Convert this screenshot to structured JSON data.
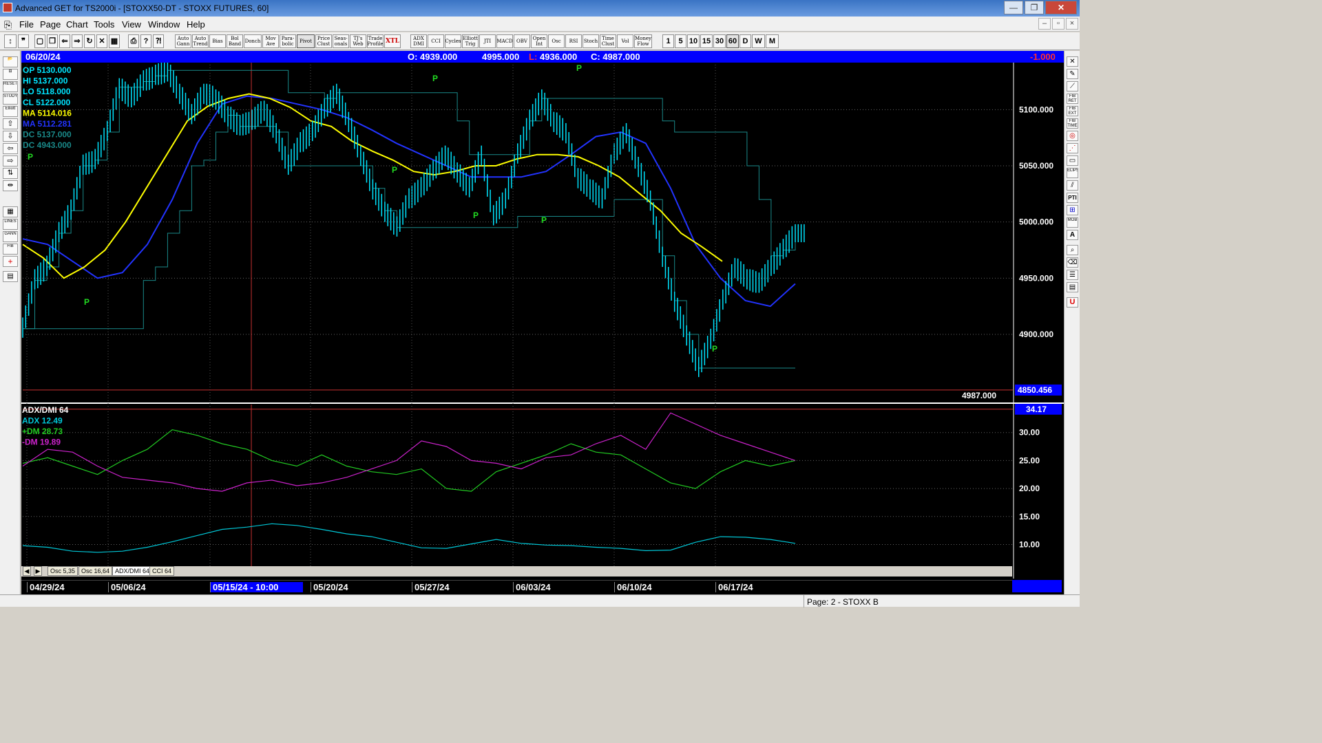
{
  "window": {
    "title": "Advanced GET for TS2000i - [STOXX50-DT - STOXX FUTURES, 60]",
    "controls": [
      "—",
      "❐",
      "✕"
    ],
    "mdi_controls": [
      "–",
      "▫",
      "×"
    ]
  },
  "menu": [
    "File",
    "Page",
    "Chart",
    "Tools",
    "View",
    "Window",
    "Help"
  ],
  "toolbar": {
    "studies": [
      "Auto Gann",
      "Auto Trend",
      "Bias",
      "Bol Band",
      "Donch",
      "Mov Ave",
      "Para-bolic",
      "Pivot",
      "Price Clust",
      "Seas-onals",
      "TJ's Web",
      "Trade Profile",
      "XTL",
      "ADX DMI",
      "CCI",
      "Cycles",
      "Elliott Trig",
      "JTI",
      "MACD",
      "OBV",
      "Open Int",
      "Osc",
      "RSI",
      "Stoch",
      "Time Clust",
      "Vol",
      "Money Flow"
    ],
    "timeframes": [
      "1",
      "5",
      "10",
      "15",
      "30",
      "60",
      "D",
      "W",
      "M"
    ],
    "active_timeframe": "60"
  },
  "info": {
    "date": "06/20/24",
    "open": "O: 4939.000",
    "high": "4995.000",
    "low_label": "L:",
    "low": "4936.000",
    "close": "C: 4987.000",
    "change": "-1.000"
  },
  "legend": [
    {
      "text": "OP  5130.000",
      "color": "#00e5ff"
    },
    {
      "text": "HI   5137.000",
      "color": "#00e5ff"
    },
    {
      "text": "LO  5118.000",
      "color": "#00e5ff"
    },
    {
      "text": "CL  5122.000",
      "color": "#00e5ff"
    },
    {
      "text": "MA  5114.016",
      "color": "#ffff00"
    },
    {
      "text": "MA  5112.281",
      "color": "#2233ff"
    },
    {
      "text": "DC  5137.000",
      "color": "#1a8a8a"
    },
    {
      "text": "DC  4943.000",
      "color": "#1a8a8a"
    }
  ],
  "price_axis": {
    "ticks": [
      "5100.000",
      "5050.000",
      "5000.000",
      "4950.000",
      "4900.000"
    ],
    "marker": "4850.456",
    "last_value": "4987.000"
  },
  "indicator": {
    "title": "ADX/DMI 64",
    "adx": "ADX 12.49",
    "plus_dm": "+DM 28.73",
    "minus_dm": "-DM  19.89",
    "marker": "34.17",
    "ticks": [
      "30.00",
      "25.00",
      "20.00",
      "15.00",
      "10.00"
    ],
    "colors": {
      "adx": "#00c8d8",
      "plus_dm": "#22cc22",
      "minus_dm": "#cc22cc"
    }
  },
  "tabs": [
    "Osc 5,35",
    "Osc 16,64",
    "ADX/DMI 64",
    "CCI 64"
  ],
  "active_tab": "ADX/DMI 64",
  "dates": [
    "04/29/24",
    "05/06/24",
    "05/15/24 - 10:00",
    "05/20/24",
    "05/27/24",
    "06/03/24",
    "06/10/24",
    "06/17/24"
  ],
  "pivot_label": "P",
  "status": "Page: 2 - STOXX B",
  "colors": {
    "price": "#00e5ff",
    "ma_fast": "#ffff00",
    "ma_slow": "#2233ff",
    "channel": "#1a8a8a",
    "pivot": "#22dd22",
    "cursor": "#c83232",
    "info_bg": "#0000ff"
  },
  "chart_data": [
    {
      "type": "line",
      "title": "",
      "series": [
        {
          "name": "",
          "values": [
            4905,
            4948,
            4960,
            4990,
            5010,
            5050,
            5055,
            5080,
            5120,
            5110,
            5125,
            5130,
            5135,
            5115,
            5095,
            5115,
            5110,
            5095,
            5085,
            5090,
            5100,
            5080,
            5050,
            5070,
            5080,
            5100,
            5115,
            5090,
            5060,
            5030,
            5010,
            4995,
            5020,
            5030,
            5045,
            5060,
            5045,
            5030,
            5060,
            5005,
            5020,
            5060,
            5090,
            5110,
            5090,
            5080,
            5040,
            5030,
            5020,
            5060,
            5080,
            5050,
            5020,
            4970,
            4930,
            4900,
            4870,
            4895,
            4930,
            4960,
            4950,
            4945,
            4960,
            4975,
            4990
          ]
        },
        {
          "name": "MA",
          "values": [
            4980,
            4968,
            4950,
            4960,
            4975,
            5000,
            5030,
            5060,
            5090,
            5103,
            5110,
            5114,
            5110,
            5102,
            5090,
            5085,
            5072,
            5063,
            5055,
            5045,
            5042,
            5045,
            5050,
            5050,
            5056,
            5060,
            5060,
            5058,
            5050,
            5040,
            5025,
            5010,
            4990,
            4978,
            4965
          ]
        },
        {
          "name": "MA",
          "values": [
            4985,
            4980,
            4965,
            4950,
            4955,
            4980,
            5020,
            5070,
            5105,
            5112,
            5110,
            5105,
            5100,
            5093,
            5082,
            5070,
            5060,
            5050,
            5040,
            5040,
            5040,
            5045,
            5060,
            5076,
            5080,
            5070,
            5030,
            4980,
            4950,
            4930,
            4925,
            4945
          ]
        }
      ],
      "xlabel": "",
      "ylabel": "",
      "categories": [
        "04/29/24",
        "05/06/24",
        "05/15/24 - 10:00",
        "05/20/24",
        "05/27/24",
        "06/03/24",
        "06/10/24",
        "06/17/24"
      ],
      "ylim": [
        4840,
        5140
      ],
      "yticks": [
        4900,
        4950,
        5000,
        5050,
        5100
      ],
      "pivots": [
        {
          "date_approx": "04/29/24",
          "kind": "high"
        },
        {
          "date_approx": "05/01/24",
          "kind": "low"
        },
        {
          "date_approx": "05/22/24",
          "kind": "low"
        },
        {
          "date_approx": "05/24/24",
          "kind": "high"
        },
        {
          "date_approx": "05/29/24",
          "kind": "low"
        },
        {
          "date_approx": "06/04/24",
          "kind": "low"
        },
        {
          "date_approx": "06/05/24",
          "kind": "high"
        },
        {
          "date_approx": "06/14/24",
          "kind": "low"
        }
      ]
    },
    {
      "type": "line",
      "title": "ADX/DMI 64",
      "series": [
        {
          "name": "ADX",
          "values": [
            9.8,
            9.5,
            8.8,
            8.6,
            8.8,
            9.5,
            10.5,
            11.6,
            12.7,
            13.1,
            13.7,
            13.4,
            12.7,
            11.9,
            11.4,
            10.4,
            9.4,
            9.3,
            10.1,
            10.9,
            10.2,
            9.9,
            9.8,
            9.5,
            9.3,
            8.9,
            9.0,
            10.4,
            11.4,
            11.3,
            10.9,
            10.2
          ]
        },
        {
          "name": "+DM",
          "values": [
            24.5,
            25.5,
            24.0,
            22.5,
            25.0,
            27.0,
            30.5,
            29.5,
            28.0,
            27.0,
            25.0,
            24.0,
            26.0,
            24.0,
            23.0,
            22.5,
            23.5,
            20.0,
            19.5,
            23.0,
            24.5,
            26.0,
            28.0,
            26.5,
            26.0,
            23.5,
            21.0,
            20.0,
            23.0,
            25.0,
            24.0,
            25.0
          ]
        },
        {
          "name": "-DM",
          "values": [
            24.0,
            27.0,
            26.5,
            24.0,
            22.0,
            21.5,
            21.0,
            20.0,
            19.5,
            21.0,
            21.5,
            20.5,
            21.0,
            22.0,
            23.5,
            25.0,
            28.5,
            27.5,
            25.0,
            24.5,
            23.5,
            25.5,
            26.0,
            28.0,
            29.5,
            27.0,
            33.5,
            31.5,
            29.5,
            28.0,
            26.5,
            25.0
          ]
        }
      ],
      "xlabel": "",
      "ylabel": "",
      "ylim": [
        6,
        35
      ],
      "yticks": [
        10,
        15,
        20,
        25,
        30
      ]
    }
  ]
}
